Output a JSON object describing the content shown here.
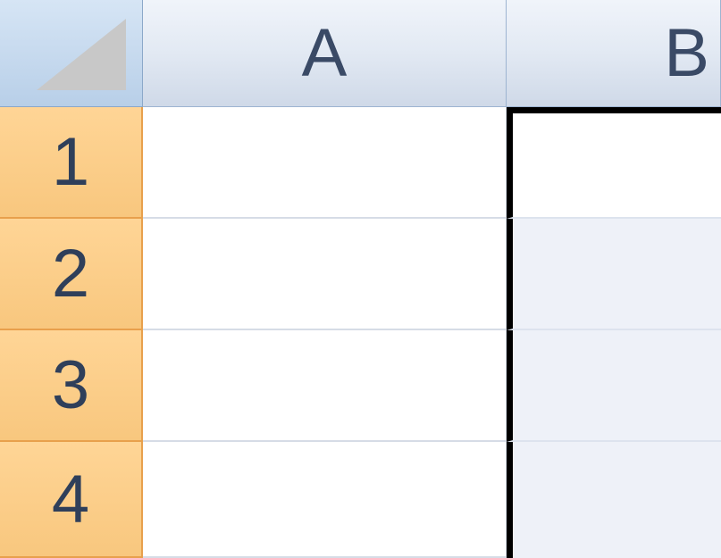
{
  "columns": {
    "A": "A",
    "B": "B"
  },
  "rows": {
    "1": "1",
    "2": "2",
    "3": "3",
    "4": "4"
  },
  "cells": {
    "A1": "",
    "A2": "",
    "A3": "",
    "A4": "",
    "B1": "",
    "B2": "",
    "B3": "",
    "B4": ""
  }
}
